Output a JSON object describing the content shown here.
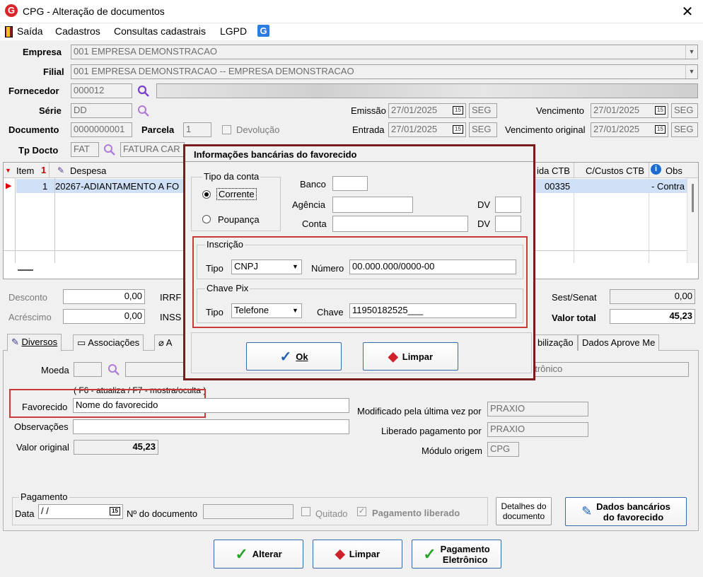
{
  "window": {
    "title": "CPG - Alteração de documentos",
    "close": "✕"
  },
  "menu": [
    "Saída",
    "Cadastros",
    "Consultas cadastrais",
    "LGPD"
  ],
  "header": {
    "empresa_label": "Empresa",
    "empresa_value": "001 EMPRESA DEMONSTRACAO",
    "filial_label": "Filial",
    "filial_value": "001 EMPRESA DEMONSTRACAO -- EMPRESA DEMONSTRACAO",
    "fornecedor_label": "Fornecedor",
    "fornecedor_value": "000012",
    "serie_label": "Série",
    "serie_value": "DD",
    "documento_label": "Documento",
    "documento_value": "0000000001",
    "parcela_label": "Parcela",
    "parcela_value": "1",
    "devolucao_label": "Devolução",
    "tpdocto_label": "Tp Docto",
    "tpdocto_code": "FAT",
    "tpdocto_desc": "FATURA CAR",
    "emissao_label": "Emissão",
    "emissao_date": "27/01/2025",
    "emissao_day": "SEG",
    "entrada_label": "Entrada",
    "entrada_date": "27/01/2025",
    "entrada_day": "SEG",
    "vencimento_label": "Vencimento",
    "vencimento_date": "27/01/2025",
    "vencimento_day": "SEG",
    "venc_orig_label": "Vencimento original",
    "venc_orig_date": "27/01/2025",
    "venc_orig_day": "SEG",
    "cal_glyph": "15"
  },
  "grid": {
    "col_item": "Item",
    "col_despesa": "Despesa",
    "col_saida": "ida CTB",
    "col_ccustos": "C/Custos CTB",
    "col_obs": "Obs",
    "row_item": "1",
    "row_despesa": "20267-ADIANTAMENTO A FO",
    "row_saida": "00335",
    "row_obs": "- Contra"
  },
  "totals": {
    "desconto_label": "Desconto",
    "desconto_value": "0,00",
    "acrescimo_label": "Acréscimo",
    "acrescimo_value": "0,00",
    "irrf_label": "IRRF",
    "inss_label": "INSS",
    "sest_label": "Sest/Senat",
    "sest_value": "0,00",
    "total_label": "Valor total",
    "total_value": "45,23"
  },
  "tabs": {
    "diversos": "Diversos",
    "associacoes": "Associações",
    "a": "A",
    "contab": "bilização",
    "aprove": "Dados Aprove Me"
  },
  "diversos": {
    "moeda_label": "Moeda",
    "hint": "( F6 - atualiza / F7 - mostra/oculta )",
    "favorecido_label": "Favorecido",
    "favorecido_value": "Nome do favorecido",
    "observacoes_label": "Observações",
    "valor_original_label": "Valor original",
    "valor_original_value": "45,23",
    "right_field_text": "etrônico",
    "modificado_label": "Modificado pela última vez por",
    "modificado_value": "PRAXIO",
    "liberado_label": "Liberado pagamento por",
    "liberado_value": "PRAXIO",
    "modulo_label": "Módulo origem",
    "modulo_value": "CPG"
  },
  "pagamento": {
    "group_label": "Pagamento",
    "data_label": "Data",
    "data_value": " /  /",
    "ndoc_label": "Nº do documento",
    "quitado_label": "Quitado",
    "liberado_label": "Pagamento liberado",
    "detalhes_label_1": "Detalhes do",
    "detalhes_label_2": "documento",
    "dados_bancarios_1": "Dados bancários",
    "dados_bancarios_2": "do favorecido"
  },
  "footer": {
    "alterar": "Alterar",
    "limpar": "Limpar",
    "pag_eletronico_1": "Pagamento",
    "pag_eletronico_2": "Eletrônico"
  },
  "dialog": {
    "title": "Informações bancárias do favorecido",
    "tipo_conta_label": "Tipo da conta",
    "corrente": "Corrente",
    "poupanca": "Poupança",
    "banco_label": "Banco",
    "agencia_label": "Agência",
    "conta_label": "Conta",
    "dv_label": "DV",
    "inscricao_label": "Inscrição",
    "insc_tipo_label": "Tipo",
    "insc_tipo_value": "CNPJ",
    "numero_label": "Número",
    "numero_value": "00.000.000/0000-00",
    "pix_label": "Chave Pix",
    "pix_tipo_label": "Tipo",
    "pix_tipo_value": "Telefone",
    "chave_label": "Chave",
    "chave_value": "11950182525___",
    "ok": "Ok",
    "limpar": "Limpar"
  },
  "colors": {
    "accent": "#3a6aa8",
    "highlight": "#c83a3a",
    "dialog_border": "#7a1c1c",
    "selected_row": "#cfe0f7"
  }
}
